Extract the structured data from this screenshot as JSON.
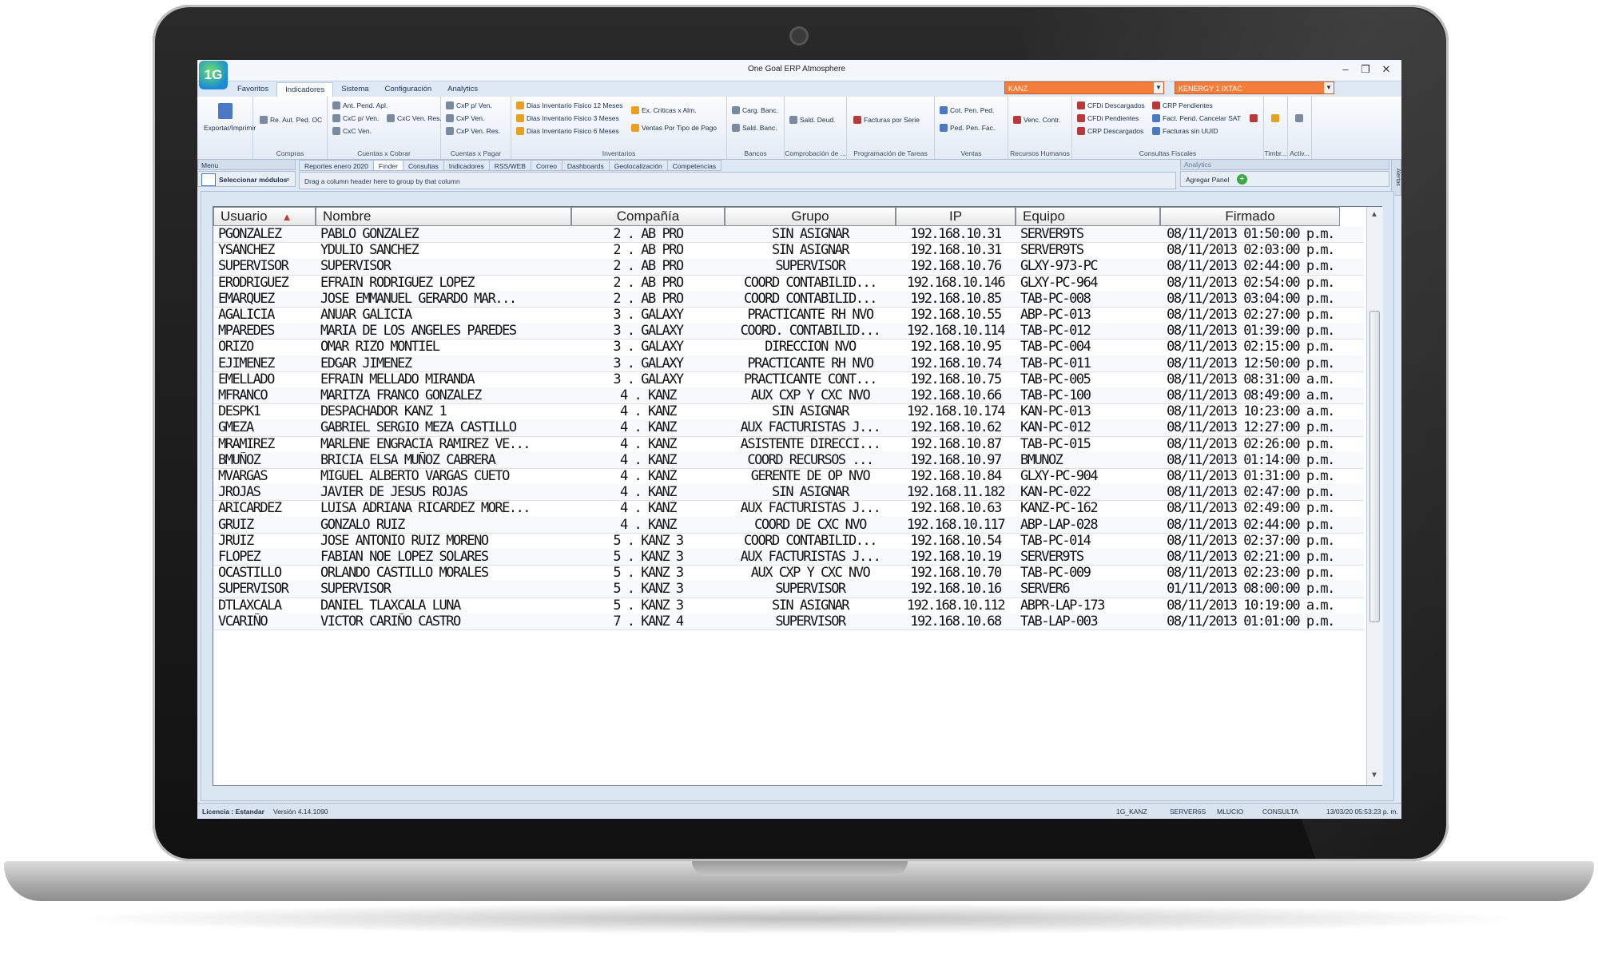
{
  "window": {
    "title": "One Goal ERP Atmosphere",
    "logo_text": "1G",
    "controls": [
      "–",
      "❐",
      "✕"
    ]
  },
  "ribbon_tabs": [
    "Favoritos",
    "Indicadores",
    "Sistema",
    "Configuración",
    "Analytics"
  ],
  "combos": {
    "company": "KANZ",
    "branch": "KENERGY 1 IXTAC"
  },
  "ribbon_groups": [
    {
      "label": "",
      "items": [
        "Exportar/Imprimir"
      ]
    },
    {
      "label": "Compras",
      "items": [
        "Re. Aut. Ped. OC"
      ]
    },
    {
      "label": "Cuentas x Cobrar",
      "items": [
        "Ant. Pend. Apl.",
        "CxC p/ Ven.",
        "CxC Ven.",
        "CxC Ven. Res."
      ]
    },
    {
      "label": "Cuentas x Pagar",
      "items": [
        "CxP p/ Ven.",
        "CxP Ven.",
        "CxP Ven. Res."
      ]
    },
    {
      "label": "Inventarios",
      "items": [
        "Dias Inventario Fisico 12 Meses",
        "Dias Inventario Fisico 3 Meses",
        "Dias Inventario Fisico 6 Meses",
        "Ex. Criticas x Alm.",
        "Ventas Por Tipo de Pago"
      ]
    },
    {
      "label": "Bancos",
      "items": [
        "Carg. Banc.",
        "Sald. Banc."
      ]
    },
    {
      "label": "Comprobación de ...",
      "items": [
        "Sald. Deud."
      ]
    },
    {
      "label": "Programación de Tareas",
      "items": [
        "Facturas por Serie"
      ]
    },
    {
      "label": "Ventas",
      "items": [
        "Cot. Pen. Ped.",
        "Ped. Pen. Fac."
      ]
    },
    {
      "label": "Recursos Humanos",
      "items": [
        "Venc. Contr."
      ]
    },
    {
      "label": "Consultas Fiscales",
      "items": [
        "CFDi Descargados",
        "CFDi Pendientes",
        "CRP Descargados",
        "CRP Pendientes",
        "Fact. Pend. Cancelar SAT",
        "Facturas sin UUID"
      ]
    },
    {
      "label": "Timbr...",
      "items": []
    },
    {
      "label": "Activ...",
      "items": []
    }
  ],
  "menu_panel": {
    "header": "Menu",
    "select_label": "Seleccionar módulos"
  },
  "doc_tabs": [
    "Reportes enero 2020",
    "Finder",
    "Consultas",
    "Indicadores",
    "RSS/WEB",
    "Correo",
    "Dashboards",
    "Geolocalización",
    "Competencias"
  ],
  "group_hint": "Drag a column header here to group by that column",
  "analytics_panel": {
    "header": "Analytics",
    "button": "Agregar Panel"
  },
  "alerts_label": "Alertas",
  "table": {
    "columns": [
      "Usuario",
      "Nombre",
      "Compañía",
      "Grupo",
      "IP",
      "Equipo",
      "Firmado"
    ],
    "sort_indicator": "▲",
    "rows": [
      [
        "PGONZALEZ",
        "PABLO GONZALEZ",
        "2 . AB PRO",
        "SIN ASIGNAR",
        "192.168.10.31",
        "SERVER9TS",
        "08/11/2013 01:50:00 p.m."
      ],
      [
        "YSANCHEZ",
        "YDULIO SANCHEZ",
        "2 . AB PRO",
        "SIN ASIGNAR",
        "192.168.10.31",
        "SERVER9TS",
        "08/11/2013 02:03:00 p.m."
      ],
      [
        "SUPERVISOR",
        "SUPERVISOR",
        "2 . AB PRO",
        "SUPERVISOR",
        "192.168.10.76",
        "GLXY-973-PC",
        "08/11/2013 02:44:00 p.m."
      ],
      [
        "ERODRIGUEZ",
        "EFRAIN RODRIGUEZ LOPEZ",
        "2 . AB PRO",
        "COORD CONTABILID...",
        "192.168.10.146",
        "GLXY-PC-964",
        "08/11/2013 02:54:00 p.m."
      ],
      [
        "EMARQUEZ",
        "JOSE EMMANUEL GERARDO MAR...",
        "2 . AB PRO",
        "COORD CONTABILID...",
        "192.168.10.85",
        "TAB-PC-008",
        "08/11/2013 03:04:00 p.m."
      ],
      [
        "AGALICIA",
        "ANUAR GALICIA",
        "3 . GALAXY",
        "PRACTICANTE RH NVO",
        "192.168.10.55",
        "ABP-PC-013",
        "08/11/2013 02:27:00 p.m."
      ],
      [
        "MPAREDES",
        "MARIA DE LOS ANGELES PAREDES",
        "3 . GALAXY",
        "COORD. CONTABILID...",
        "192.168.10.114",
        "TAB-PC-012",
        "08/11/2013 01:39:00 p.m."
      ],
      [
        "ORIZO",
        "OMAR RIZO MONTIEL",
        "3 . GALAXY",
        "DIRECCION NVO",
        "192.168.10.95",
        "TAB-PC-004",
        "08/11/2013 02:15:00 p.m."
      ],
      [
        "EJIMENEZ",
        "EDGAR JIMENEZ",
        "3 . GALAXY",
        "PRACTICANTE RH NVO",
        "192.168.10.74",
        "TAB-PC-011",
        "08/11/2013 12:50:00 p.m."
      ],
      [
        "EMELLADO",
        "EFRAIN MELLADO MIRANDA",
        "3 . GALAXY",
        "PRACTICANTE CONT...",
        "192.168.10.75",
        "TAB-PC-005",
        "08/11/2013 08:31:00 a.m."
      ],
      [
        "MFRANCO",
        "MARITZA FRANCO GONZALEZ",
        "4 . KANZ",
        "AUX CXP Y CXC NVO",
        "192.168.10.66",
        "TAB-PC-100",
        "08/11/2013 08:49:00 a.m."
      ],
      [
        "DESPK1",
        "DESPACHADOR KANZ 1",
        "4 . KANZ",
        "SIN ASIGNAR",
        "192.168.10.174",
        "KAN-PC-013",
        "08/11/2013 10:23:00 a.m."
      ],
      [
        "GMEZA",
        "GABRIEL SERGIO MEZA CASTILLO",
        "4 . KANZ",
        "AUX FACTURISTAS J...",
        "192.168.10.62",
        "KAN-PC-012",
        "08/11/2013 12:27:00 p.m."
      ],
      [
        "MRAMIREZ",
        "MARLENE ENGRACIA RAMIREZ VE...",
        "4 . KANZ",
        "ASISTENTE DIRECCI...",
        "192.168.10.87",
        "TAB-PC-015",
        "08/11/2013 02:26:00 p.m."
      ],
      [
        "BMUÑOZ",
        "BRICIA ELSA MUÑOZ CABRERA",
        "4 . KANZ",
        "COORD RECURSOS ...",
        "192.168.10.97",
        "BMUNOZ",
        "08/11/2013 01:14:00 p.m."
      ],
      [
        "MVARGAS",
        "MIGUEL ALBERTO VARGAS CUETO",
        "4 . KANZ",
        "GERENTE DE OP NVO",
        "192.168.10.84",
        "GLXY-PC-904",
        "08/11/2013 01:31:00 p.m."
      ],
      [
        "JROJAS",
        "JAVIER DE JESUS ROJAS",
        "4 . KANZ",
        "SIN ASIGNAR",
        "192.168.11.182",
        "KAN-PC-022",
        "08/11/2013 02:47:00 p.m."
      ],
      [
        "ARICARDEZ",
        "LUISA ADRIANA RICARDEZ MORE...",
        "4 . KANZ",
        "AUX FACTURISTAS J...",
        "192.168.10.63",
        "KANZ-PC-162",
        "08/11/2013 02:49:00 p.m."
      ],
      [
        "GRUIZ",
        "GONZALO RUIZ",
        "4 . KANZ",
        "COORD DE CXC NVO",
        "192.168.10.117",
        "ABP-LAP-028",
        "08/11/2013 02:44:00 p.m."
      ],
      [
        "JRUIZ",
        "JOSE ANTONIO RUIZ MORENO",
        "5 . KANZ 3",
        "COORD CONTABILID...",
        "192.168.10.54",
        "TAB-PC-014",
        "08/11/2013 02:37:00 p.m."
      ],
      [
        "FLOPEZ",
        "FABIAN NOE LOPEZ SOLARES",
        "5 . KANZ 3",
        "AUX FACTURISTAS J...",
        "192.168.10.19",
        "SERVER9TS",
        "08/11/2013 02:21:00 p.m."
      ],
      [
        "OCASTILLO",
        "ORLANDO CASTILLO MORALES",
        "5 . KANZ 3",
        "AUX CXP Y CXC NVO",
        "192.168.10.70",
        "TAB-PC-009",
        "08/11/2013 02:23:00 p.m."
      ],
      [
        "SUPERVISOR",
        "SUPERVISOR",
        "5 . KANZ 3",
        "SUPERVISOR",
        "192.168.10.16",
        "SERVER6",
        "01/11/2013 08:00:00 p.m."
      ],
      [
        "DTLAXCALA",
        "DANIEL TLAXCALA LUNA",
        "5 . KANZ 3",
        "SIN ASIGNAR",
        "192.168.10.112",
        "ABPR-LAP-173",
        "08/11/2013 10:19:00 a.m."
      ],
      [
        "VCARIÑO",
        "VICTOR CARIÑO CASTRO",
        "7 . KANZ 4",
        "SUPERVISOR",
        "192.168.10.68",
        "TAB-LAP-003",
        "08/11/2013 01:01:00 p.m."
      ]
    ]
  },
  "status": {
    "license": "Licencia : Estandar",
    "version": "Versión 4.14.1090",
    "db": "1G_KANZ",
    "server": "SERVER6S",
    "user": "MLUCIO",
    "mode": "CONSULTA",
    "datetime": "13/03/20 05:53:23 p. m."
  }
}
